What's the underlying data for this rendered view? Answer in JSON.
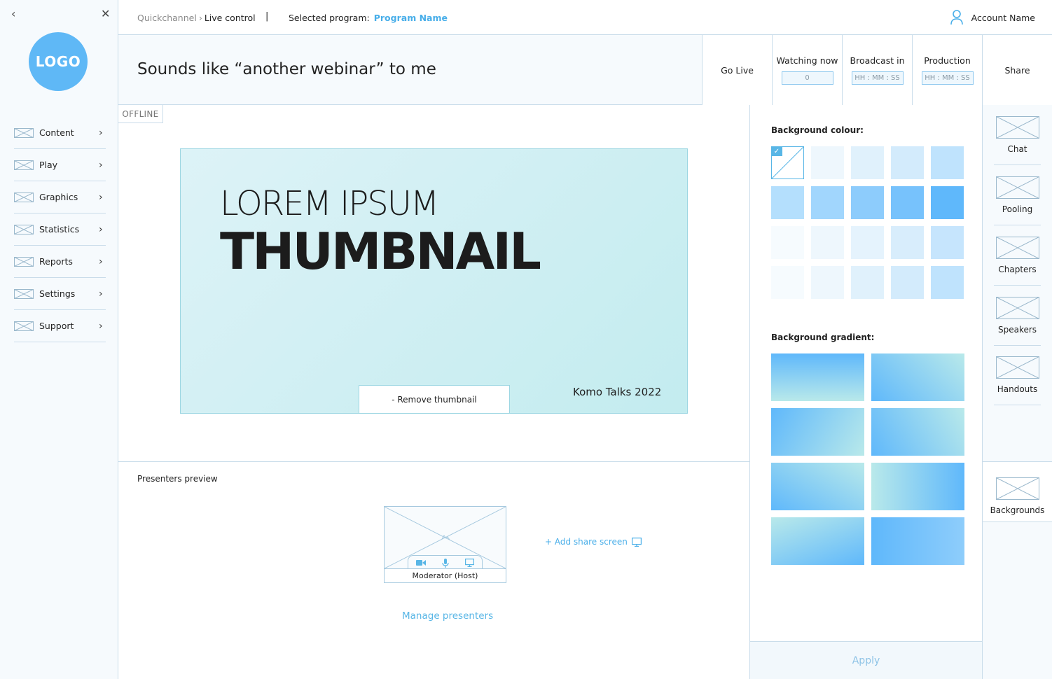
{
  "sidebar": {
    "logo": "LOGO",
    "items": [
      {
        "label": "Content"
      },
      {
        "label": "Play"
      },
      {
        "label": "Graphics"
      },
      {
        "label": "Statistics"
      },
      {
        "label": "Reports"
      },
      {
        "label": "Settings"
      },
      {
        "label": "Support"
      }
    ]
  },
  "topbar": {
    "breadcrumb_root": "Quickchannel",
    "breadcrumb_current": "Live control",
    "divider": "|",
    "selected_program_label": "Selected program:",
    "program_name": "Program Name",
    "account_name": "Account Name"
  },
  "header": {
    "title": "Sounds like “another webinar” to me",
    "go_live": "Go Live",
    "watching_label": "Watching now",
    "watching_value": "0",
    "broadcast_label": "Broadcast in",
    "broadcast_value": "HH : MM : SS",
    "production_label": "Production",
    "production_value": "HH : MM : SS",
    "share": "Share"
  },
  "status": "OFFLINE",
  "thumbnail": {
    "line1": "LOREM IPSUM",
    "line2": "THUMBNAIL",
    "event": "Komo Talks 2022",
    "remove_label": "- Remove thumbnail"
  },
  "presenters": {
    "label": "Presenters preview",
    "presenter_name": "Moderator (Host)",
    "add_share": "+ Add share screen",
    "manage": "Manage presenters"
  },
  "panel": {
    "bg_colour_label": "Background colour:",
    "bg_gradient_label": "Background gradient:",
    "apply": "Apply",
    "colors": [
      [
        "#ffffff",
        "#eef7fd",
        "#e0f1fc",
        "#d3ebfc",
        "#bfe3fd"
      ],
      [
        "#b4dffd",
        "#a1d6fd",
        "#8dccfc",
        "#77c2fc",
        "#5fb8fb"
      ],
      [
        "#f6fbfe",
        "#eef7fd",
        "#e5f3fd",
        "#d8edfc",
        "#c6e5fd"
      ],
      [
        "#f6fbfe",
        "#eef7fd",
        "#e0f1fc",
        "#d3ebfc",
        "#bfe3fd"
      ]
    ],
    "gradients": [
      {
        "from": "#5fb8fb",
        "to": "#b9e9ea",
        "angle": "180deg"
      },
      {
        "from": "#5fb8fb",
        "to": "#b9e9ea",
        "angle": "45deg"
      },
      {
        "from": "#5fb8fb",
        "to": "#b9e9ea",
        "angle": "120deg"
      },
      {
        "from": "#5fb8fb",
        "to": "#b9e9ea",
        "angle": "60deg"
      },
      {
        "from": "#5fb8fb",
        "to": "#b9e9ea",
        "angle": "30deg"
      },
      {
        "from": "#b9e9ea",
        "to": "#5fb8fb",
        "angle": "90deg"
      },
      {
        "from": "#b9e9ea",
        "to": "#5fb8fb",
        "angle": "160deg"
      },
      {
        "from": "#5fb8fb",
        "to": "#8ecdfb",
        "angle": "90deg"
      }
    ]
  },
  "rail": {
    "items": [
      {
        "label": "Chat"
      },
      {
        "label": "Pooling"
      },
      {
        "label": "Chapters"
      },
      {
        "label": "Speakers"
      },
      {
        "label": "Handouts"
      }
    ],
    "backgrounds": "Backgrounds"
  }
}
